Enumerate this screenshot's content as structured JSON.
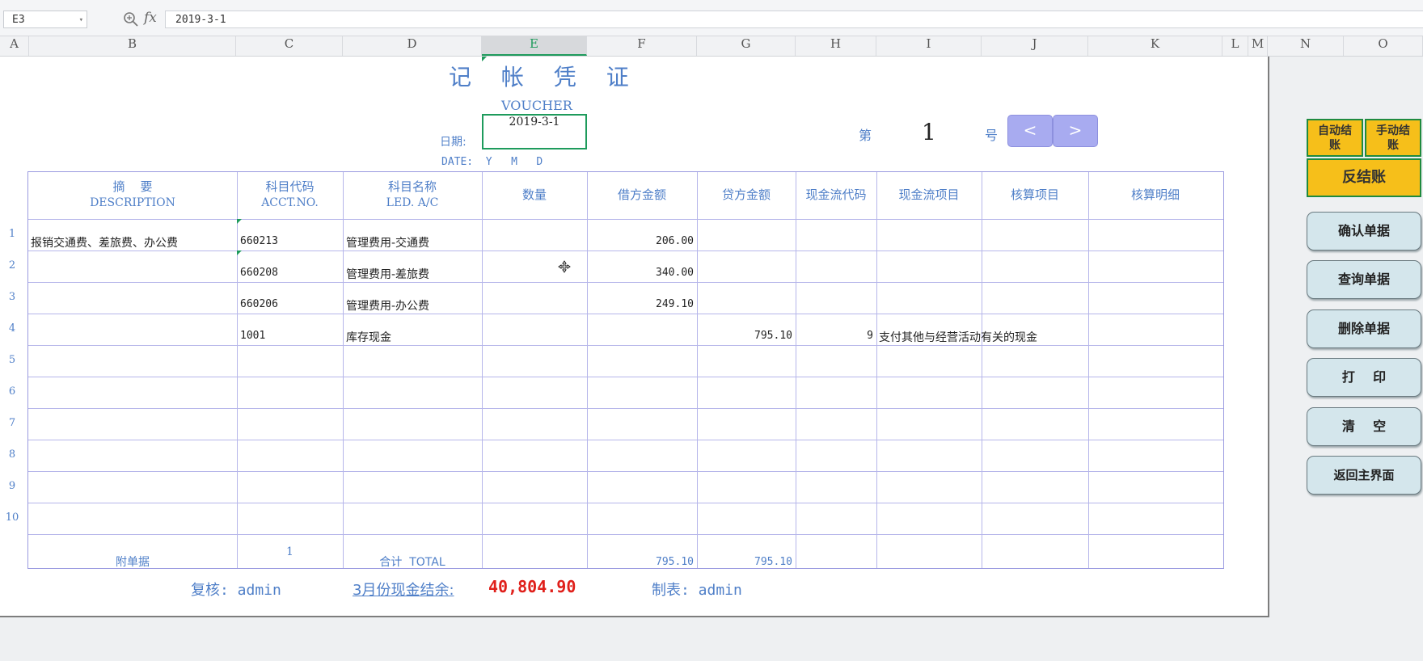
{
  "formula_bar": {
    "cell_ref": "E3",
    "formula": "2019-3-1",
    "fx_label": "fx"
  },
  "columns": [
    "A",
    "B",
    "C",
    "D",
    "E",
    "F",
    "G",
    "H",
    "I",
    "J",
    "K",
    "L",
    "M",
    "N",
    "O"
  ],
  "voucher": {
    "title": "记 帐 凭 证",
    "title_en": "VOUCHER",
    "date_label": "日期:",
    "date_value": "2019-3-1",
    "date_en": "DATE:  Y   M   D",
    "no_prefix": "第",
    "no_value": "1",
    "no_suffix": "号",
    "prev": "<",
    "next": ">"
  },
  "headers": {
    "desc_cn": "摘    要",
    "desc_en": "DESCRIPTION",
    "code_cn": "科目代码",
    "code_en": "ACCT.NO.",
    "name_cn": "科目名称",
    "name_en": "LED. A/C",
    "qty": "数量",
    "debit": "借方金额",
    "credit": "贷方金额",
    "cf_code": "现金流代码",
    "cf_item": "现金流项目",
    "calc_item": "核算项目",
    "calc_detail": "核算明细"
  },
  "row_numbers": [
    "1",
    "2",
    "3",
    "4",
    "5",
    "6",
    "7",
    "8",
    "9",
    "10"
  ],
  "rows": [
    {
      "desc": "报销交通费、差旅费、办公费",
      "code": "660213",
      "name": "管理费用-交通费",
      "debit": "206.00",
      "credit": "",
      "cf_code": "",
      "cf_item": ""
    },
    {
      "desc": "",
      "code": "660208",
      "name": "管理费用-差旅费",
      "debit": "340.00",
      "credit": "",
      "cf_code": "",
      "cf_item": ""
    },
    {
      "desc": "",
      "code": "660206",
      "name": "管理费用-办公费",
      "debit": "249.10",
      "credit": "",
      "cf_code": "",
      "cf_item": ""
    },
    {
      "desc": "",
      "code": "1001",
      "name": "库存现金",
      "debit": "",
      "credit": "795.10",
      "cf_code": "9",
      "cf_item": "支付其他与经营活动有关的现金"
    }
  ],
  "footer": {
    "attach_label": "附单据",
    "attach_count": "1",
    "total_label": "合计  TOTAL",
    "total_debit": "795.10",
    "total_credit": "795.10",
    "reviewer": "复核: admin",
    "cash_label": "3月份现金结余:",
    "cash_value": "40,804.90",
    "maker": "制表: admin"
  },
  "buttons": {
    "auto_close": "自动结账",
    "manual_close": "手动结账",
    "reverse_close": "反结账",
    "confirm": "确认单据",
    "query": "查询单据",
    "delete": "删除单据",
    "print": "打    印",
    "clear": "清    空",
    "home": "返回主界面"
  },
  "colors": {
    "accent": "#4f7fc8",
    "grid": "#b6b6ea",
    "selected": "#1e9b5c",
    "cash_red": "#e0201b",
    "yellow_btn": "#f6bf1a"
  }
}
